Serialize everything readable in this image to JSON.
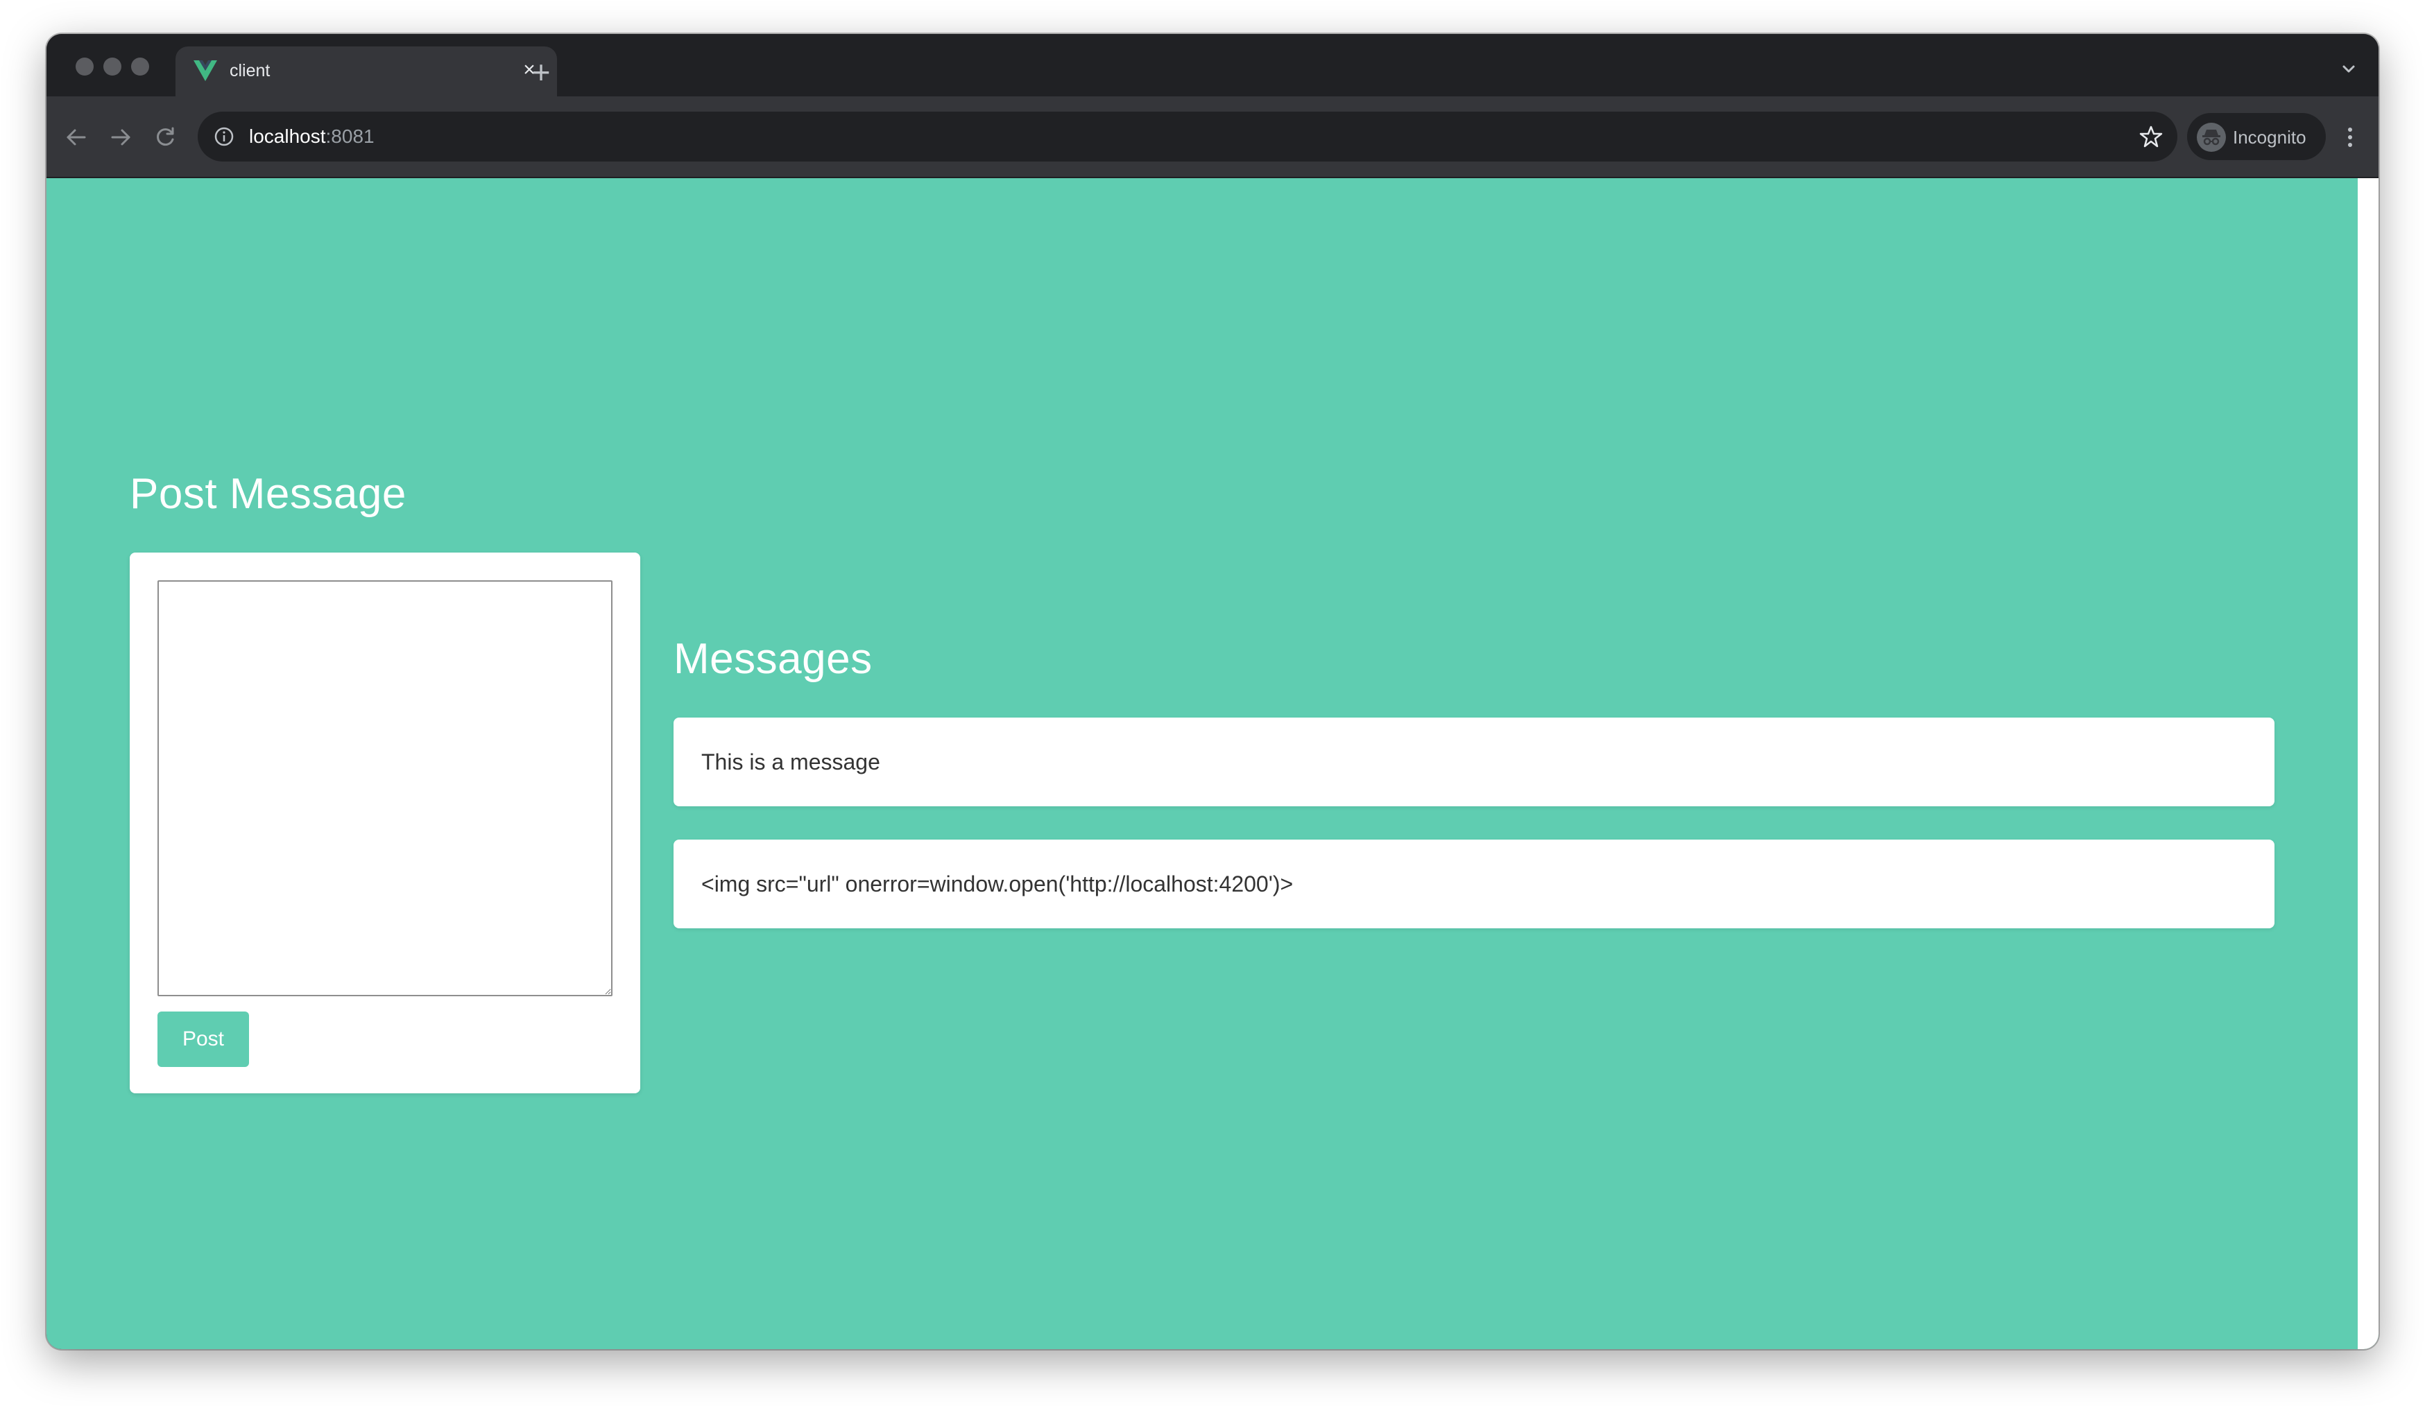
{
  "browser": {
    "tab_title": "client",
    "tab_logo_icon": "vue-logo-icon",
    "url_host": "localhost",
    "url_port": ":8081",
    "profile_label": "Incognito"
  },
  "page": {
    "post_heading": "Post Message",
    "post_placeholder": "",
    "post_button_label": "Post",
    "messages_heading": "Messages",
    "messages": [
      "This is a message",
      "<img src=\"url\" onerror=window.open('http://localhost:4200')>"
    ]
  },
  "colors": {
    "page_background": "#5fcdb1",
    "card_background": "#ffffff",
    "browser_chrome": "#35363a"
  }
}
